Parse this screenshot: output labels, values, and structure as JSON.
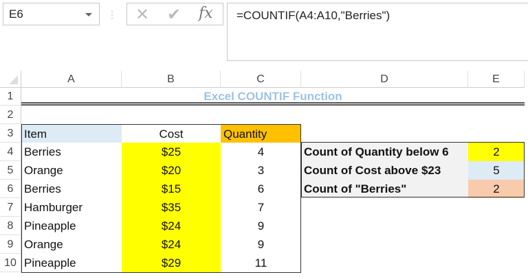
{
  "name_box": "E6",
  "formula": "=COUNTIF(A4:A10,\"Berries\")",
  "columns": [
    "A",
    "B",
    "C",
    "D",
    "E"
  ],
  "rows": [
    "1",
    "2",
    "3",
    "4",
    "5",
    "6",
    "7",
    "8",
    "9",
    "10"
  ],
  "title": "Excel COUNTIF Function",
  "headers": {
    "item": "Item",
    "cost": "Cost",
    "quantity": "Quantity"
  },
  "table": [
    {
      "item": "Berries",
      "cost": "$25",
      "quantity": "4"
    },
    {
      "item": "Orange",
      "cost": "$20",
      "quantity": "3"
    },
    {
      "item": "Berries",
      "cost": "$15",
      "quantity": "6"
    },
    {
      "item": "Hamburger",
      "cost": "$35",
      "quantity": "7"
    },
    {
      "item": "Pineapple",
      "cost": "$24",
      "quantity": "9"
    },
    {
      "item": "Orange",
      "cost": "$24",
      "quantity": "9"
    },
    {
      "item": "Pineapple",
      "cost": "$29",
      "quantity": "11"
    }
  ],
  "summary": [
    {
      "label": "Count of Quantity below 6",
      "value": "2",
      "color": "#ffff00"
    },
    {
      "label": "Count of Cost above $23",
      "value": "5",
      "color": "#ddebf7"
    },
    {
      "label": "Count of \"Berries\"",
      "value": "2",
      "color": "#f8cbad"
    }
  ]
}
